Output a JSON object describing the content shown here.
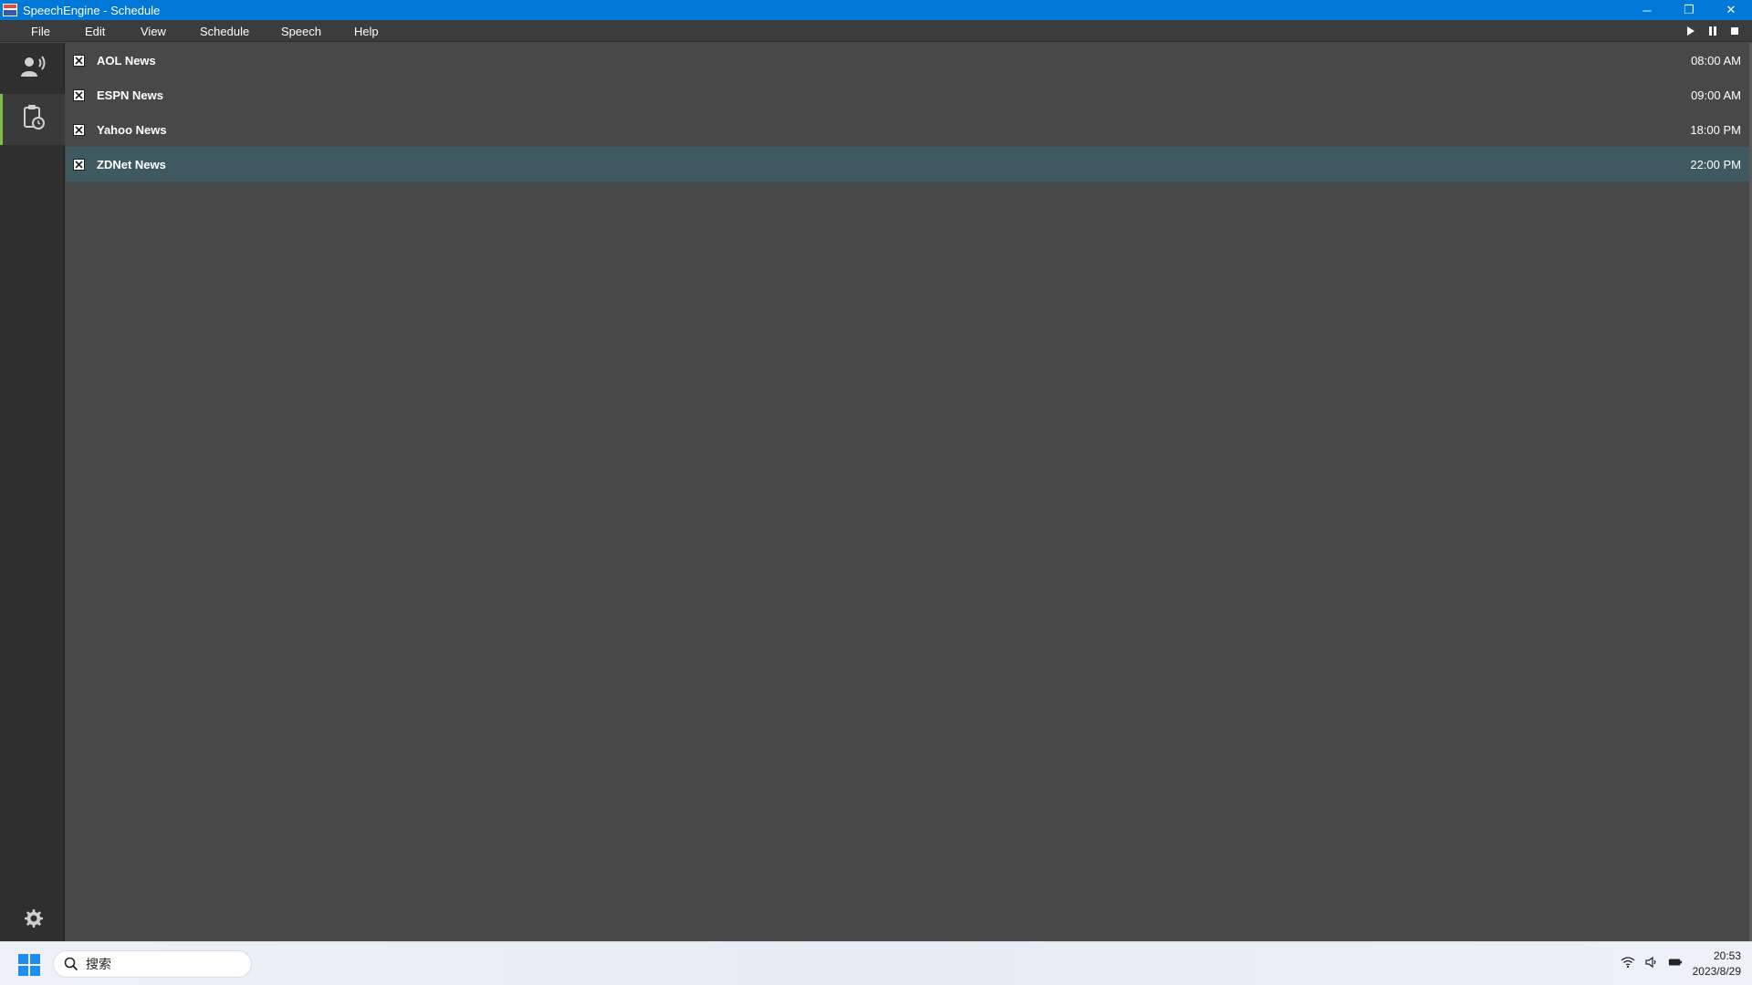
{
  "window": {
    "title": "SpeechEngine - Schedule",
    "controls": {
      "minimize": "─",
      "restore": "❐",
      "close": "✕"
    }
  },
  "menu": {
    "items": [
      "File",
      "Edit",
      "View",
      "Schedule",
      "Speech",
      "Help"
    ]
  },
  "transport": {
    "icons": [
      "play-icon",
      "pause-icon",
      "stop-icon"
    ]
  },
  "sidebar": {
    "items": [
      {
        "name": "speaker-icon",
        "active": false
      },
      {
        "name": "schedule-clipboard-icon",
        "active": true
      }
    ],
    "settings_icon": "gear-icon",
    "accent_color": "#7ac143"
  },
  "schedule": {
    "rows": [
      {
        "name": "AOL News",
        "time": "08:00 AM",
        "checked": true,
        "selected": false
      },
      {
        "name": "ESPN News",
        "time": "09:00 AM",
        "checked": true,
        "selected": false
      },
      {
        "name": "Yahoo News",
        "time": "18:00 PM",
        "checked": true,
        "selected": false
      },
      {
        "name": "ZDNet News",
        "time": "22:00 PM",
        "checked": true,
        "selected": true
      }
    ]
  },
  "taskbar": {
    "search_placeholder": "搜索",
    "time": "20:53",
    "date": "2023/8/29"
  },
  "colors": {
    "titlebar": "#0078d7",
    "selected_row": "#3e5a60",
    "background": "#484848",
    "sidebar": "#2f2f2f"
  }
}
